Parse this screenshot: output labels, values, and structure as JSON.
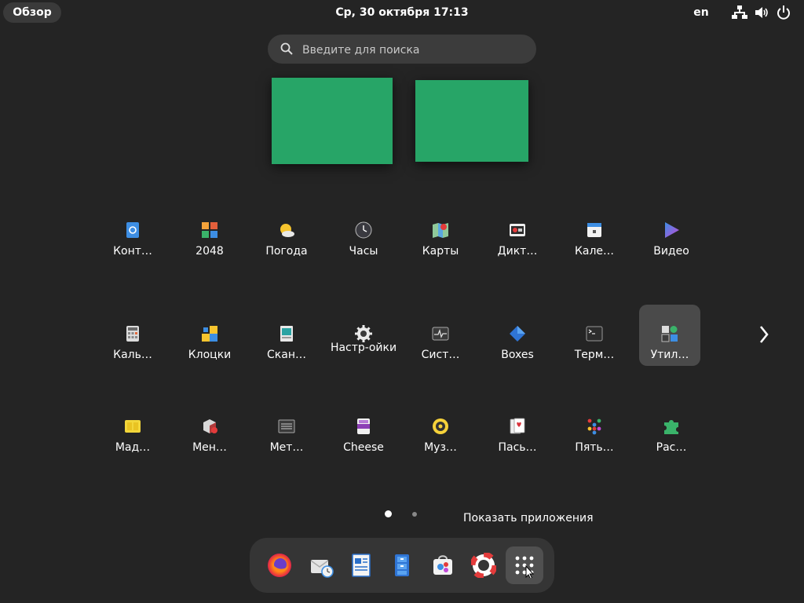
{
  "topbar": {
    "activities_label": "Обзор",
    "clock": "Ср, 30 октября  17:13",
    "language": "en",
    "tray_icons": [
      "network-icon",
      "volume-icon",
      "power-icon"
    ]
  },
  "search": {
    "placeholder": "Введите для поиска"
  },
  "workspaces": {
    "color": "#27a567",
    "count": 2
  },
  "app_grid": {
    "rows": [
      [
        {
          "label": "Конт…",
          "icon": "contacts-icon"
        },
        {
          "label": "2048",
          "icon": "game-2048-icon"
        },
        {
          "label": "Погода",
          "icon": "weather-icon"
        },
        {
          "label": "Часы",
          "icon": "clock-icon"
        },
        {
          "label": "Карты",
          "icon": "maps-icon"
        },
        {
          "label": "Дикт…",
          "icon": "recorder-icon"
        },
        {
          "label": "Кале…",
          "icon": "calendar-icon"
        },
        {
          "label": "Видео",
          "icon": "video-icon"
        }
      ],
      [
        {
          "label": "Каль…",
          "icon": "calculator-icon"
        },
        {
          "label": "Клоцки",
          "icon": "klotski-icon"
        },
        {
          "label": "Скан…",
          "icon": "scanner-icon"
        },
        {
          "label": "Настр-ойки",
          "icon": "settings-gear-icon"
        },
        {
          "label": "Сист…",
          "icon": "system-monitor-icon"
        },
        {
          "label": "Boxes",
          "icon": "boxes-icon"
        },
        {
          "label": "Терм…",
          "icon": "terminal-icon"
        },
        {
          "label": "Утил…",
          "icon": "utilities-folder-icon",
          "selected": true
        }
      ],
      [
        {
          "label": "Мад…",
          "icon": "mahjongg-icon"
        },
        {
          "label": "Мен…",
          "icon": "package-manager-icon"
        },
        {
          "label": "Мет…",
          "icon": "metadata-icon"
        },
        {
          "label": "Cheese",
          "icon": "cheese-icon"
        },
        {
          "label": "Муз…",
          "icon": "music-icon"
        },
        {
          "label": "Пась…",
          "icon": "solitaire-icon"
        },
        {
          "label": "Пять…",
          "icon": "five-or-more-icon"
        },
        {
          "label": "Рас…",
          "icon": "extensions-puzzle-icon"
        }
      ]
    ]
  },
  "pager": {
    "pages": 2,
    "current": 1
  },
  "dash": {
    "tooltip": "Показать приложения",
    "items": [
      {
        "name": "firefox",
        "icon": "firefox-icon"
      },
      {
        "name": "mail",
        "icon": "mail-clock-icon"
      },
      {
        "name": "writer",
        "icon": "writer-document-icon"
      },
      {
        "name": "files",
        "icon": "file-cabinet-icon"
      },
      {
        "name": "software",
        "icon": "software-bag-icon"
      },
      {
        "name": "help",
        "icon": "help-lifebuoy-icon"
      },
      {
        "name": "show-apps",
        "icon": "app-grid-icon",
        "active": true
      }
    ]
  }
}
